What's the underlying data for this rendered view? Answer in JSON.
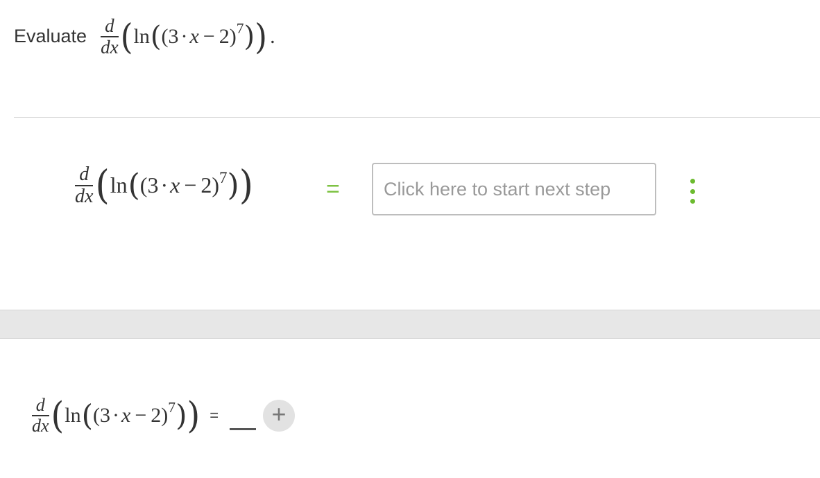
{
  "problem": {
    "evaluate_label": "Evaluate",
    "expression": {
      "d_numerator": "d",
      "d_denominator": "dx",
      "function": "ln",
      "coefficient": "3",
      "cdot": "·",
      "variable": "x",
      "minus": "−",
      "constant": "2",
      "exponent": "7"
    },
    "period": "."
  },
  "step": {
    "equals": "=",
    "next_step_placeholder": "Click here to start next step",
    "more_icon": "vertical-ellipsis-icon",
    "accent_color": "#7dc242"
  },
  "answer": {
    "equals": "=",
    "add_icon": "plus-icon"
  },
  "paren": {
    "open": "(",
    "close": ")"
  }
}
